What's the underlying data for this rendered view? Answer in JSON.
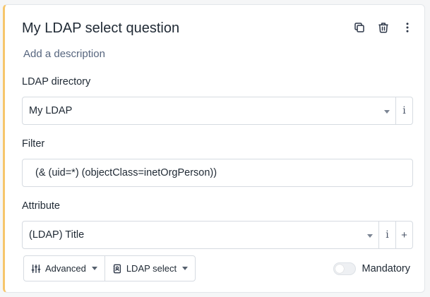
{
  "question": {
    "title": "My LDAP select question",
    "description_placeholder": "Add a description"
  },
  "actions": {
    "icons": [
      "copy-icon",
      "trash-icon",
      "more-vertical-icon"
    ]
  },
  "ldap_directory": {
    "label": "LDAP directory",
    "value": "My LDAP",
    "info": "i"
  },
  "filter": {
    "label": "Filter",
    "value": "(& (uid=*) (objectClass=inetOrgPerson))"
  },
  "attribute": {
    "label": "Attribute",
    "value": "(LDAP) Title",
    "info": "i",
    "add": "+"
  },
  "toolbar": {
    "advanced_label": "Advanced",
    "type_label": "LDAP select"
  },
  "mandatory": {
    "label": "Mandatory",
    "checked": false
  },
  "colors": {
    "accent_border": "#f6c66b",
    "text": "#212b36",
    "muted": "#56657e"
  }
}
